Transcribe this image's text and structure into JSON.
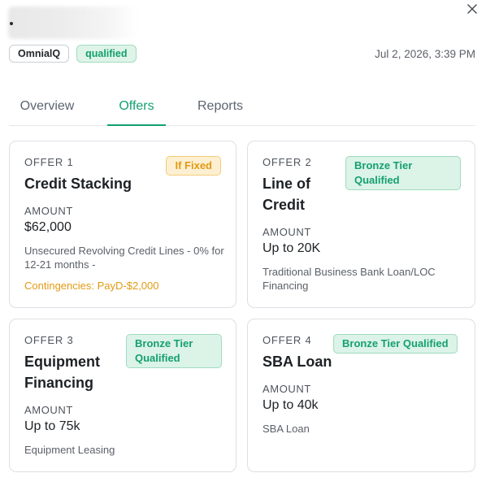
{
  "header": {
    "source_chip": "OmnialQ",
    "status_chip": "qualified",
    "timestamp": "Jul 2, 2026, 3:39 PM"
  },
  "tabs": [
    {
      "label": "Overview",
      "active": false
    },
    {
      "label": "Offers",
      "active": true
    },
    {
      "label": "Reports",
      "active": false
    }
  ],
  "offers": [
    {
      "number": "OFFER 1",
      "title": "Credit Stacking",
      "badge": "If Fixed",
      "badge_style": "amber",
      "amount_label": "AMOUNT",
      "amount": "$62,000",
      "description": "Unsecured Revolving Credit Lines - 0% for 12-21 months -",
      "contingencies": "Contingencies: PayD-$2,000"
    },
    {
      "number": "OFFER 2",
      "title": "Line of Credit",
      "badge": "Bronze Tier Qualified",
      "badge_style": "green",
      "amount_label": "AMOUNT",
      "amount": "Up to 20K",
      "description": "Traditional Business Bank Loan/LOC Financing"
    },
    {
      "number": "OFFER 3",
      "title": "Equipment Financing",
      "badge": "Bronze Tier Qualified",
      "badge_style": "green",
      "amount_label": "AMOUNT",
      "amount": "Up to 75k",
      "description": "Equipment Leasing"
    },
    {
      "number": "OFFER 4",
      "title": "SBA Loan",
      "badge": "Bronze Tier Qualified",
      "badge_style": "green",
      "amount_label": "AMOUNT",
      "amount": "Up to 40k",
      "description": "SBA Loan"
    }
  ],
  "colors": {
    "accent": "#14a06f",
    "badge_green_bg": "#dcf3e8",
    "badge_amber_text": "#e29a14",
    "border": "#dcdfe4"
  },
  "icons": {
    "close": "close-icon"
  }
}
